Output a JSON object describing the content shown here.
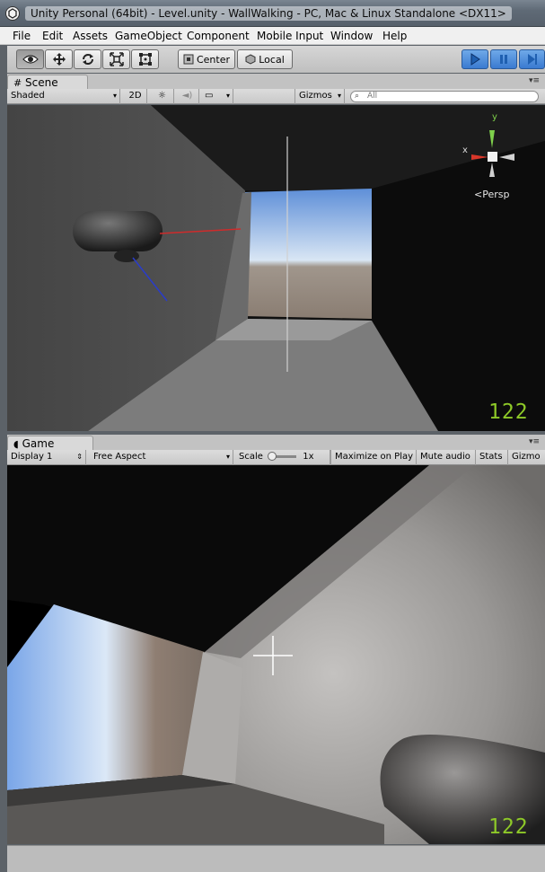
{
  "window": {
    "title": "Unity Personal (64bit) - Level.unity - WallWalking - PC, Mac & Linux Standalone <DX11>"
  },
  "menu": {
    "items": [
      "File",
      "Edit",
      "Assets",
      "GameObject",
      "Component",
      "Mobile Input",
      "Window",
      "Help"
    ]
  },
  "toolbar": {
    "tools": [
      "view-tool",
      "move-tool",
      "rotate-tool",
      "scale-tool",
      "rect-tool"
    ],
    "pivot_label": "Center",
    "space_label": "Local",
    "play_controls": [
      "play",
      "pause",
      "step"
    ]
  },
  "scene": {
    "tab_label": "Scene",
    "shading_mode": "Shaded",
    "mode_2d": "2D",
    "gizmos_label": "Gizmos",
    "search_placeholder": "All",
    "persp_label": "Persp",
    "axis_labels": {
      "x": "x",
      "y": "y"
    },
    "fps": "122"
  },
  "game": {
    "tab_label": "Game",
    "display_label": "Display 1",
    "aspect_label": "Free Aspect",
    "scale_label": "Scale",
    "scale_value": "1x",
    "maximize_label": "Maximize on Play",
    "mute_label": "Mute audio",
    "stats_label": "Stats",
    "gizmos_label": "Gizmo",
    "fps": "122"
  },
  "colors": {
    "accent_play": "#3a7ad0",
    "fps_text": "#8ec928",
    "axis_x": "#d8372a",
    "axis_y": "#7ed04b",
    "axis_z": "#2a5ad8"
  }
}
